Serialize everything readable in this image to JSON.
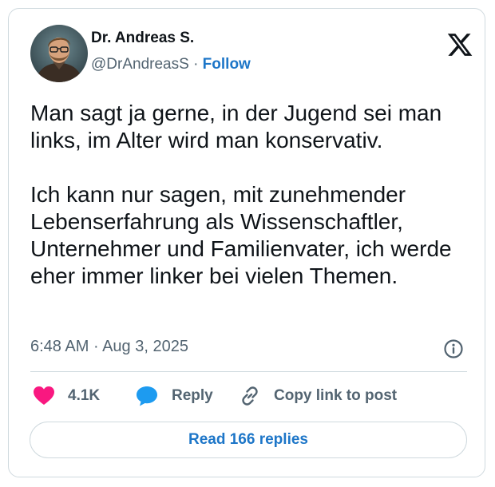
{
  "author": {
    "name": "Dr. Andreas S.",
    "handle": "@DrAndreasS",
    "separator": "·",
    "follow_label": "Follow"
  },
  "tweet": {
    "text": "Man sagt ja gerne, in der Jugend sei man links, im Alter wird man konservativ.\n\nIch kann nur sagen, mit zunehmender Lebenserfahrung als Wissenschaftler, Unternehmer und Familienvater, ich werde eher immer linker bei vielen Themen.",
    "time": "6:48 AM",
    "date_separator": "·",
    "date": "Aug 3, 2025"
  },
  "actions": {
    "likes_count": "4.1K",
    "reply_label": "Reply",
    "copy_link_label": "Copy link to post"
  },
  "read_replies_label": "Read 166 replies",
  "icons": {
    "platform": "x-logo-icon",
    "info": "info-icon",
    "like": "heart-icon",
    "reply": "speech-bubble-icon",
    "copy": "link-icon"
  },
  "colors": {
    "link_blue": "#1d76c8",
    "heart_pink": "#f91880",
    "reply_blue": "#1d9bf0",
    "secondary_text": "#536471",
    "border": "#cfd9de"
  }
}
